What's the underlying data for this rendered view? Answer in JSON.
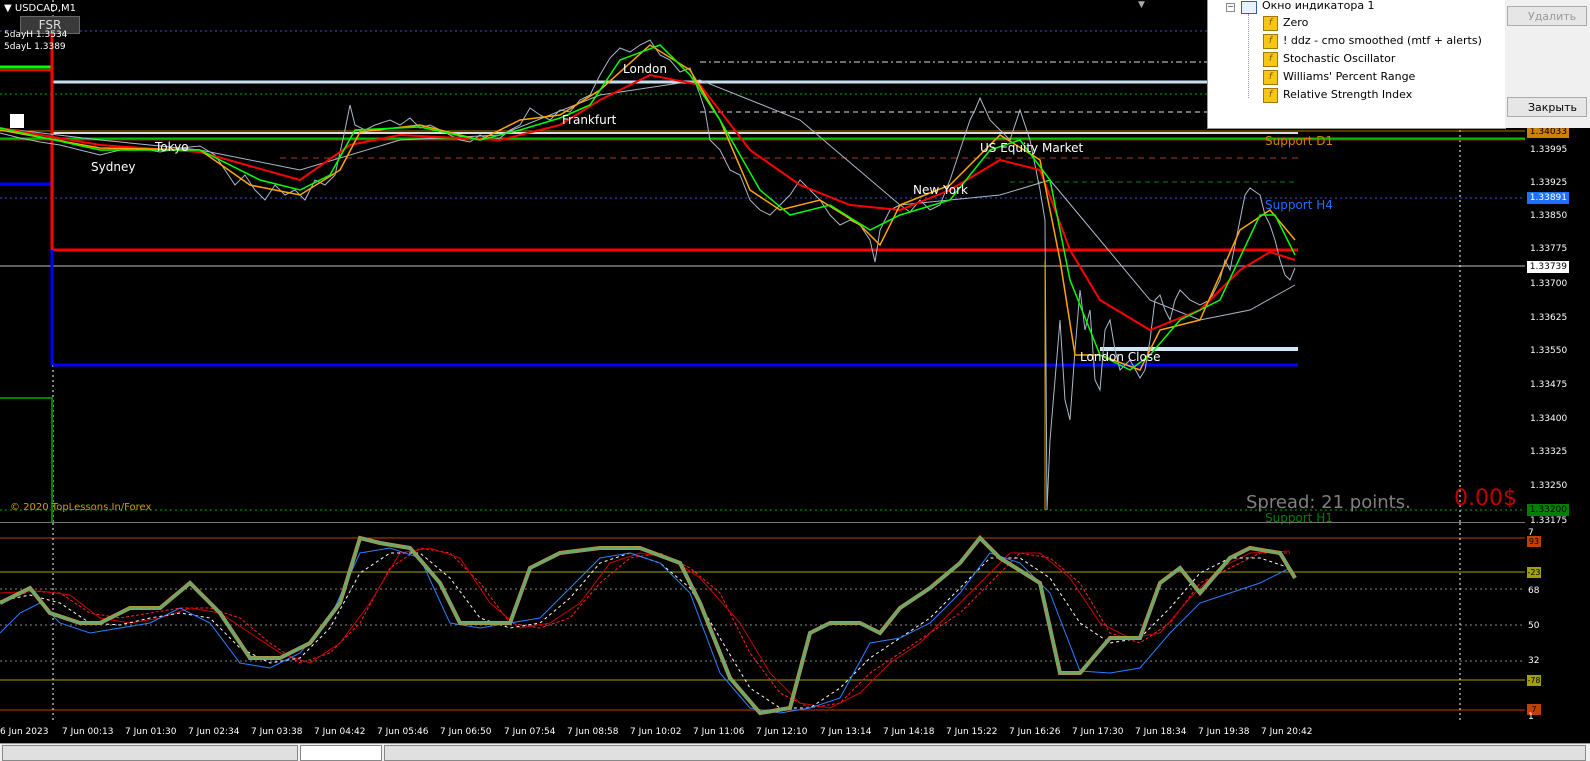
{
  "symbol_title": "USDCAD,M1",
  "fsr_button": "FSR",
  "five_day_high": "5dayH 1.3534",
  "five_day_low": "5dayL 1.3389",
  "copyright": "© 2020 TopLessons.In/Forex",
  "spread": "Spread: 21 points.",
  "pnl": "0.00$",
  "sessions": {
    "sydney": "Sydney",
    "tokyo": "Tokyo",
    "frankfurt": "Frankfurt",
    "london": "London",
    "us_equity": "US Equity Market",
    "new_york": "New York",
    "london_close": "London Close"
  },
  "levels": {
    "support_d1": "Support D1",
    "support_h4": "Support H4",
    "support_h1": "Support H1"
  },
  "navigator": {
    "window_name": "Окно индикатора 1",
    "items": [
      "Zero",
      "! ddz - cmo smoothed (mtf + alerts)",
      "Stochastic Oscillator",
      "Williams' Percent Range",
      "Relative Strength Index"
    ],
    "btn_delete": "Удалить",
    "btn_close": "Закрыть"
  },
  "price_scale": {
    "tag_upper": "1.34033",
    "tag_blue": "1.33891",
    "tag_current": "1.33739",
    "tag_bottom": "1.33200",
    "labels": [
      "1.33995",
      "1.33925",
      "1.33850",
      "1.33775",
      "1.33700",
      "1.33625",
      "1.33550",
      "1.33475",
      "1.33400",
      "1.33325",
      "1.33250",
      "1.33175"
    ]
  },
  "osc_scale": {
    "tag_top": "93",
    "tag_upper": "-23",
    "tag_lower": "-78",
    "tag_bottom": "7",
    "top_num": "7",
    "labels": [
      "68",
      "50",
      "32",
      "1"
    ]
  },
  "time_axis": [
    "6 Jun 2023",
    "7 Jun 00:13",
    "7 Jun 01:30",
    "7 Jun 02:34",
    "7 Jun 03:38",
    "7 Jun 04:42",
    "7 Jun 05:46",
    "7 Jun 06:50",
    "7 Jun 07:54",
    "7 Jun 08:58",
    "7 Jun 10:02",
    "7 Jun 11:06",
    "7 Jun 12:10",
    "7 Jun 13:14",
    "7 Jun 14:18",
    "7 Jun 15:22",
    "7 Jun 16:26",
    "7 Jun 17:30",
    "7 Jun 18:34",
    "7 Jun 19:38",
    "7 Jun 20:42"
  ],
  "colors": {
    "support": "#ff2020",
    "resistance_blue": "#0000ff",
    "sma_fast": "#00ff00",
    "sma_mid": "#ff0000",
    "sma_slow": "#ffa500",
    "price_line": "#aab8c8",
    "d1_label": "#d08000",
    "h4_label": "#1f6fff",
    "h1_label": "#008000"
  }
}
